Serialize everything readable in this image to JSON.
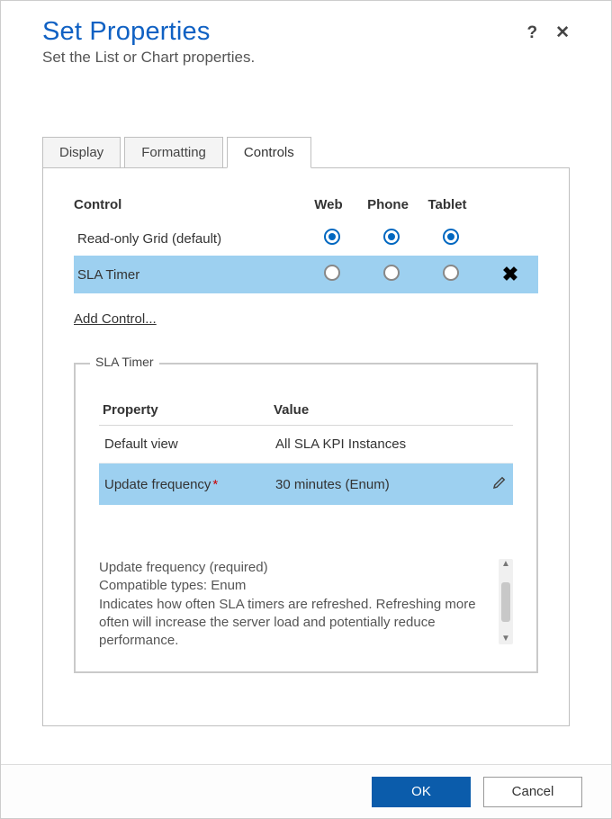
{
  "header": {
    "title": "Set Properties",
    "subtitle": "Set the List or Chart properties.",
    "help_symbol": "?",
    "close_symbol": "✕"
  },
  "tabs": [
    {
      "label": "Display",
      "active": false
    },
    {
      "label": "Formatting",
      "active": false
    },
    {
      "label": "Controls",
      "active": true
    }
  ],
  "controls_table": {
    "columns": {
      "control": "Control",
      "web": "Web",
      "phone": "Phone",
      "tablet": "Tablet"
    },
    "rows": [
      {
        "name": "Read-only Grid (default)",
        "web": true,
        "phone": true,
        "tablet": true,
        "removable": false,
        "selected": false
      },
      {
        "name": "SLA Timer",
        "web": false,
        "phone": false,
        "tablet": false,
        "removable": true,
        "selected": true
      }
    ],
    "add_link": "Add Control..."
  },
  "fieldset": {
    "legend": "SLA Timer",
    "columns": {
      "property": "Property",
      "value": "Value"
    },
    "rows": [
      {
        "property": "Default view",
        "value": "All SLA KPI Instances",
        "required": false,
        "selected": false,
        "editable": false
      },
      {
        "property": "Update frequency",
        "value": "30 minutes (Enum)",
        "required": true,
        "selected": true,
        "editable": true
      }
    ],
    "description": {
      "line1": "Update frequency (required)",
      "line2": "Compatible types: Enum",
      "body": "Indicates how often SLA timers are refreshed. Refreshing more often will increase the server load and potentially reduce performance."
    }
  },
  "footer": {
    "ok": "OK",
    "cancel": "Cancel"
  }
}
